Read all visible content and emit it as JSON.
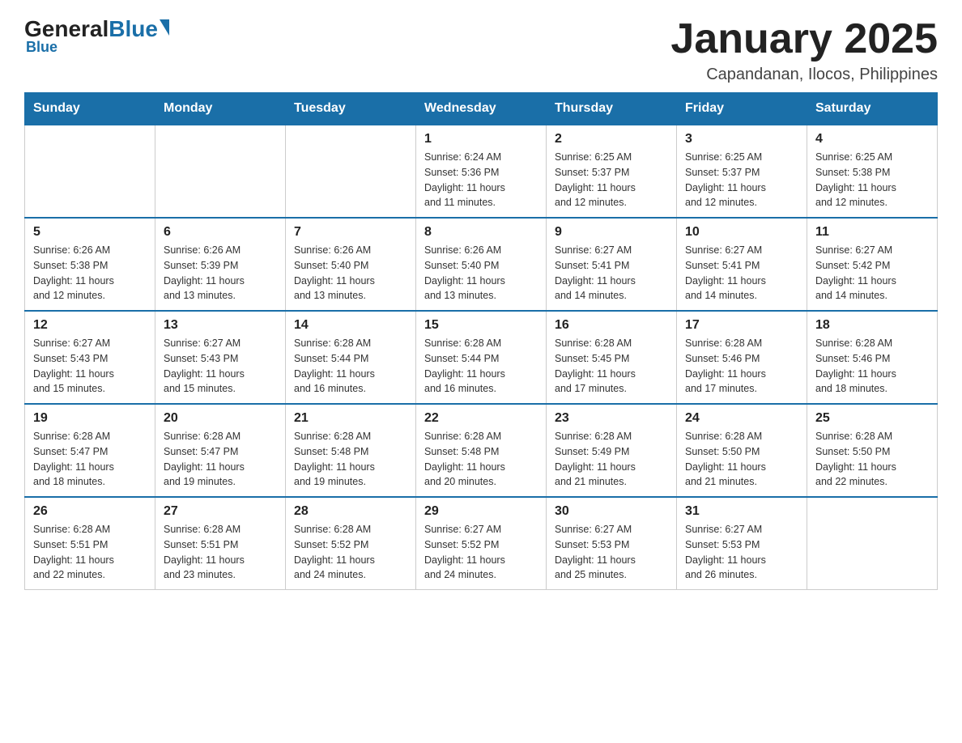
{
  "header": {
    "logo": {
      "general": "General",
      "blue": "Blue"
    },
    "title": "January 2025",
    "subtitle": "Capandanan, Ilocos, Philippines"
  },
  "days_of_week": [
    "Sunday",
    "Monday",
    "Tuesday",
    "Wednesday",
    "Thursday",
    "Friday",
    "Saturday"
  ],
  "weeks": [
    [
      {
        "day": "",
        "info": ""
      },
      {
        "day": "",
        "info": ""
      },
      {
        "day": "",
        "info": ""
      },
      {
        "day": "1",
        "info": "Sunrise: 6:24 AM\nSunset: 5:36 PM\nDaylight: 11 hours\nand 11 minutes."
      },
      {
        "day": "2",
        "info": "Sunrise: 6:25 AM\nSunset: 5:37 PM\nDaylight: 11 hours\nand 12 minutes."
      },
      {
        "day": "3",
        "info": "Sunrise: 6:25 AM\nSunset: 5:37 PM\nDaylight: 11 hours\nand 12 minutes."
      },
      {
        "day": "4",
        "info": "Sunrise: 6:25 AM\nSunset: 5:38 PM\nDaylight: 11 hours\nand 12 minutes."
      }
    ],
    [
      {
        "day": "5",
        "info": "Sunrise: 6:26 AM\nSunset: 5:38 PM\nDaylight: 11 hours\nand 12 minutes."
      },
      {
        "day": "6",
        "info": "Sunrise: 6:26 AM\nSunset: 5:39 PM\nDaylight: 11 hours\nand 13 minutes."
      },
      {
        "day": "7",
        "info": "Sunrise: 6:26 AM\nSunset: 5:40 PM\nDaylight: 11 hours\nand 13 minutes."
      },
      {
        "day": "8",
        "info": "Sunrise: 6:26 AM\nSunset: 5:40 PM\nDaylight: 11 hours\nand 13 minutes."
      },
      {
        "day": "9",
        "info": "Sunrise: 6:27 AM\nSunset: 5:41 PM\nDaylight: 11 hours\nand 14 minutes."
      },
      {
        "day": "10",
        "info": "Sunrise: 6:27 AM\nSunset: 5:41 PM\nDaylight: 11 hours\nand 14 minutes."
      },
      {
        "day": "11",
        "info": "Sunrise: 6:27 AM\nSunset: 5:42 PM\nDaylight: 11 hours\nand 14 minutes."
      }
    ],
    [
      {
        "day": "12",
        "info": "Sunrise: 6:27 AM\nSunset: 5:43 PM\nDaylight: 11 hours\nand 15 minutes."
      },
      {
        "day": "13",
        "info": "Sunrise: 6:27 AM\nSunset: 5:43 PM\nDaylight: 11 hours\nand 15 minutes."
      },
      {
        "day": "14",
        "info": "Sunrise: 6:28 AM\nSunset: 5:44 PM\nDaylight: 11 hours\nand 16 minutes."
      },
      {
        "day": "15",
        "info": "Sunrise: 6:28 AM\nSunset: 5:44 PM\nDaylight: 11 hours\nand 16 minutes."
      },
      {
        "day": "16",
        "info": "Sunrise: 6:28 AM\nSunset: 5:45 PM\nDaylight: 11 hours\nand 17 minutes."
      },
      {
        "day": "17",
        "info": "Sunrise: 6:28 AM\nSunset: 5:46 PM\nDaylight: 11 hours\nand 17 minutes."
      },
      {
        "day": "18",
        "info": "Sunrise: 6:28 AM\nSunset: 5:46 PM\nDaylight: 11 hours\nand 18 minutes."
      }
    ],
    [
      {
        "day": "19",
        "info": "Sunrise: 6:28 AM\nSunset: 5:47 PM\nDaylight: 11 hours\nand 18 minutes."
      },
      {
        "day": "20",
        "info": "Sunrise: 6:28 AM\nSunset: 5:47 PM\nDaylight: 11 hours\nand 19 minutes."
      },
      {
        "day": "21",
        "info": "Sunrise: 6:28 AM\nSunset: 5:48 PM\nDaylight: 11 hours\nand 19 minutes."
      },
      {
        "day": "22",
        "info": "Sunrise: 6:28 AM\nSunset: 5:48 PM\nDaylight: 11 hours\nand 20 minutes."
      },
      {
        "day": "23",
        "info": "Sunrise: 6:28 AM\nSunset: 5:49 PM\nDaylight: 11 hours\nand 21 minutes."
      },
      {
        "day": "24",
        "info": "Sunrise: 6:28 AM\nSunset: 5:50 PM\nDaylight: 11 hours\nand 21 minutes."
      },
      {
        "day": "25",
        "info": "Sunrise: 6:28 AM\nSunset: 5:50 PM\nDaylight: 11 hours\nand 22 minutes."
      }
    ],
    [
      {
        "day": "26",
        "info": "Sunrise: 6:28 AM\nSunset: 5:51 PM\nDaylight: 11 hours\nand 22 minutes."
      },
      {
        "day": "27",
        "info": "Sunrise: 6:28 AM\nSunset: 5:51 PM\nDaylight: 11 hours\nand 23 minutes."
      },
      {
        "day": "28",
        "info": "Sunrise: 6:28 AM\nSunset: 5:52 PM\nDaylight: 11 hours\nand 24 minutes."
      },
      {
        "day": "29",
        "info": "Sunrise: 6:27 AM\nSunset: 5:52 PM\nDaylight: 11 hours\nand 24 minutes."
      },
      {
        "day": "30",
        "info": "Sunrise: 6:27 AM\nSunset: 5:53 PM\nDaylight: 11 hours\nand 25 minutes."
      },
      {
        "day": "31",
        "info": "Sunrise: 6:27 AM\nSunset: 5:53 PM\nDaylight: 11 hours\nand 26 minutes."
      },
      {
        "day": "",
        "info": ""
      }
    ]
  ]
}
